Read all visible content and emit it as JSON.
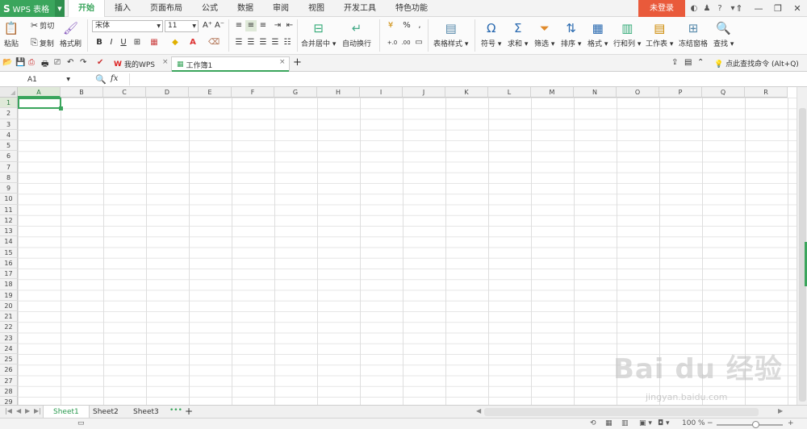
{
  "app": {
    "logo": "S",
    "name": "WPS 表格"
  },
  "menu": {
    "tabs": [
      "开始",
      "插入",
      "页面布局",
      "公式",
      "数据",
      "审阅",
      "视图",
      "开发工具",
      "特色功能"
    ],
    "active": "开始",
    "login": "未登录"
  },
  "ribbon": {
    "clipboard": {
      "paste": "粘贴",
      "cut": "剪切",
      "copy": "复制",
      "format_painter": "格式刷"
    },
    "font": {
      "name": "宋体",
      "size": "11",
      "bold": "B",
      "italic": "I",
      "underline": "U"
    },
    "merge_center": "合并居中",
    "wrap_text": "自动换行",
    "number": {
      "percent": "%",
      "comma": ",",
      "inc_decimal": "+.0 .00",
      "dec_decimal": ".00 +.0"
    },
    "table_style": "表格样式",
    "symbol": "符号",
    "sum": "求和",
    "filter": "筛选",
    "sort": "排序",
    "format": "格式",
    "rows_cols": "行和列",
    "worksheet": "工作表",
    "freeze": "冻结窗格",
    "find": "查找"
  },
  "doc_tabs": [
    {
      "label": "我的WPS"
    },
    {
      "label": "工作簿1"
    }
  ],
  "search_hint": "点此查找命令 (Alt+Q)",
  "formula_bar": {
    "cell_ref": "A1",
    "fx": "fx",
    "value": ""
  },
  "grid": {
    "columns": [
      "A",
      "B",
      "C",
      "D",
      "E",
      "F",
      "G",
      "H",
      "I",
      "J",
      "K",
      "L",
      "M",
      "N",
      "O",
      "P",
      "Q",
      "R"
    ],
    "rows": [
      "1",
      "2",
      "3",
      "4",
      "5",
      "6",
      "7",
      "8",
      "9",
      "10",
      "11",
      "12",
      "13",
      "14",
      "15",
      "16",
      "17",
      "18",
      "19",
      "20",
      "21",
      "22",
      "23",
      "24",
      "25",
      "26",
      "27",
      "28",
      "29"
    ],
    "active_cell": "A1"
  },
  "sheets": {
    "tabs": [
      "Sheet1",
      "Sheet2",
      "Sheet3"
    ],
    "active": "Sheet1",
    "more": "•••",
    "add": "+"
  },
  "status": {
    "zoom": "100 %"
  },
  "watermark": {
    "text": "Bai du 经验",
    "sub": "jingyan.baidu.com"
  },
  "colors": {
    "accent": "#3aa55c",
    "login_bg": "#e95a3b"
  }
}
